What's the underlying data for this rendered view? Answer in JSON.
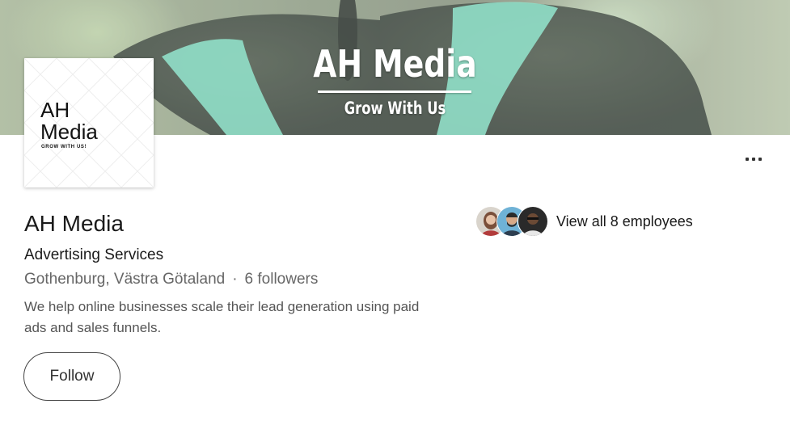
{
  "banner": {
    "title": "AH Media",
    "subtitle": "Grow  With Us"
  },
  "logo": {
    "line1": "AH",
    "line2": "Media",
    "tagline": "GROW WITH US!"
  },
  "company": {
    "name": "AH Media",
    "industry": "Advertising Services",
    "location": "Gothenburg, Västra Götaland",
    "separator": "·",
    "followers": "6 followers",
    "description": "We help online businesses scale their lead generation using paid ads and sales funnels."
  },
  "actions": {
    "follow_label": "Follow"
  },
  "employees": {
    "link_text": "View all 8 employees",
    "avatars": [
      "employee-avatar",
      "employee-avatar",
      "employee-avatar"
    ]
  },
  "icons": {
    "more": "more-options-icon"
  },
  "colors": {
    "text_primary": "#1a1a1a",
    "text_secondary": "#666666",
    "banner_accent": "#7fe0c2"
  }
}
